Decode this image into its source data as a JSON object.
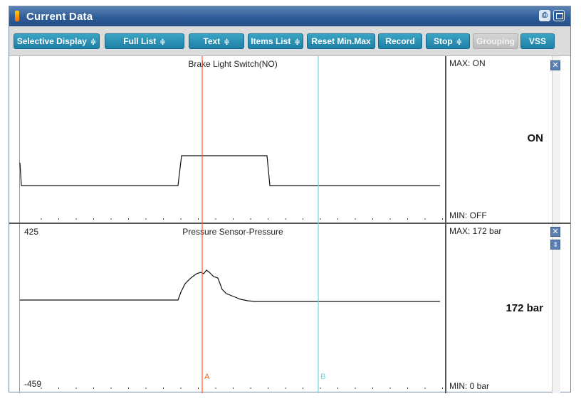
{
  "window": {
    "title": "Current Data"
  },
  "toolbar": {
    "buttons": [
      {
        "label": "Selective Display",
        "arrow": "≑",
        "disabled": false
      },
      {
        "label": "Full List",
        "arrow": "≑",
        "disabled": false
      },
      {
        "label": "Text",
        "arrow": "≑",
        "disabled": false
      },
      {
        "label": "Items List",
        "arrow": "≑",
        "disabled": false
      },
      {
        "label": "Reset Min.Max",
        "arrow": "",
        "disabled": false
      },
      {
        "label": "Record",
        "arrow": "",
        "disabled": false
      },
      {
        "label": "Stop",
        "arrow": "≑",
        "disabled": false
      },
      {
        "label": "Grouping",
        "arrow": "",
        "disabled": true
      },
      {
        "label": "VSS",
        "arrow": "",
        "disabled": false
      }
    ]
  },
  "cursors": {
    "a_label": "A",
    "b_label": "B",
    "a_color": "#ff5a1a",
    "b_color": "#66d9e8"
  },
  "panels": [
    {
      "title": "Brake Light Switch(NO)",
      "max_label": "MAX: ON",
      "min_label": "MIN: OFF",
      "current": "ON",
      "y_top": "",
      "y_bottom": ""
    },
    {
      "title": "Pressure Sensor-Pressure",
      "max_label": "MAX:   172 bar",
      "min_label": "MIN:     0 bar",
      "current": "172 bar",
      "y_top": "425",
      "y_bottom": "-459"
    }
  ],
  "icons": {
    "title_icon": "window-icon",
    "print": "print-icon",
    "restore": "restore-icon",
    "close": "close-icon",
    "updown": "up-down-icon"
  },
  "colors": {
    "titlebar": "#2c5a96",
    "button": "#1f7fa6",
    "signal": "#111111"
  }
}
